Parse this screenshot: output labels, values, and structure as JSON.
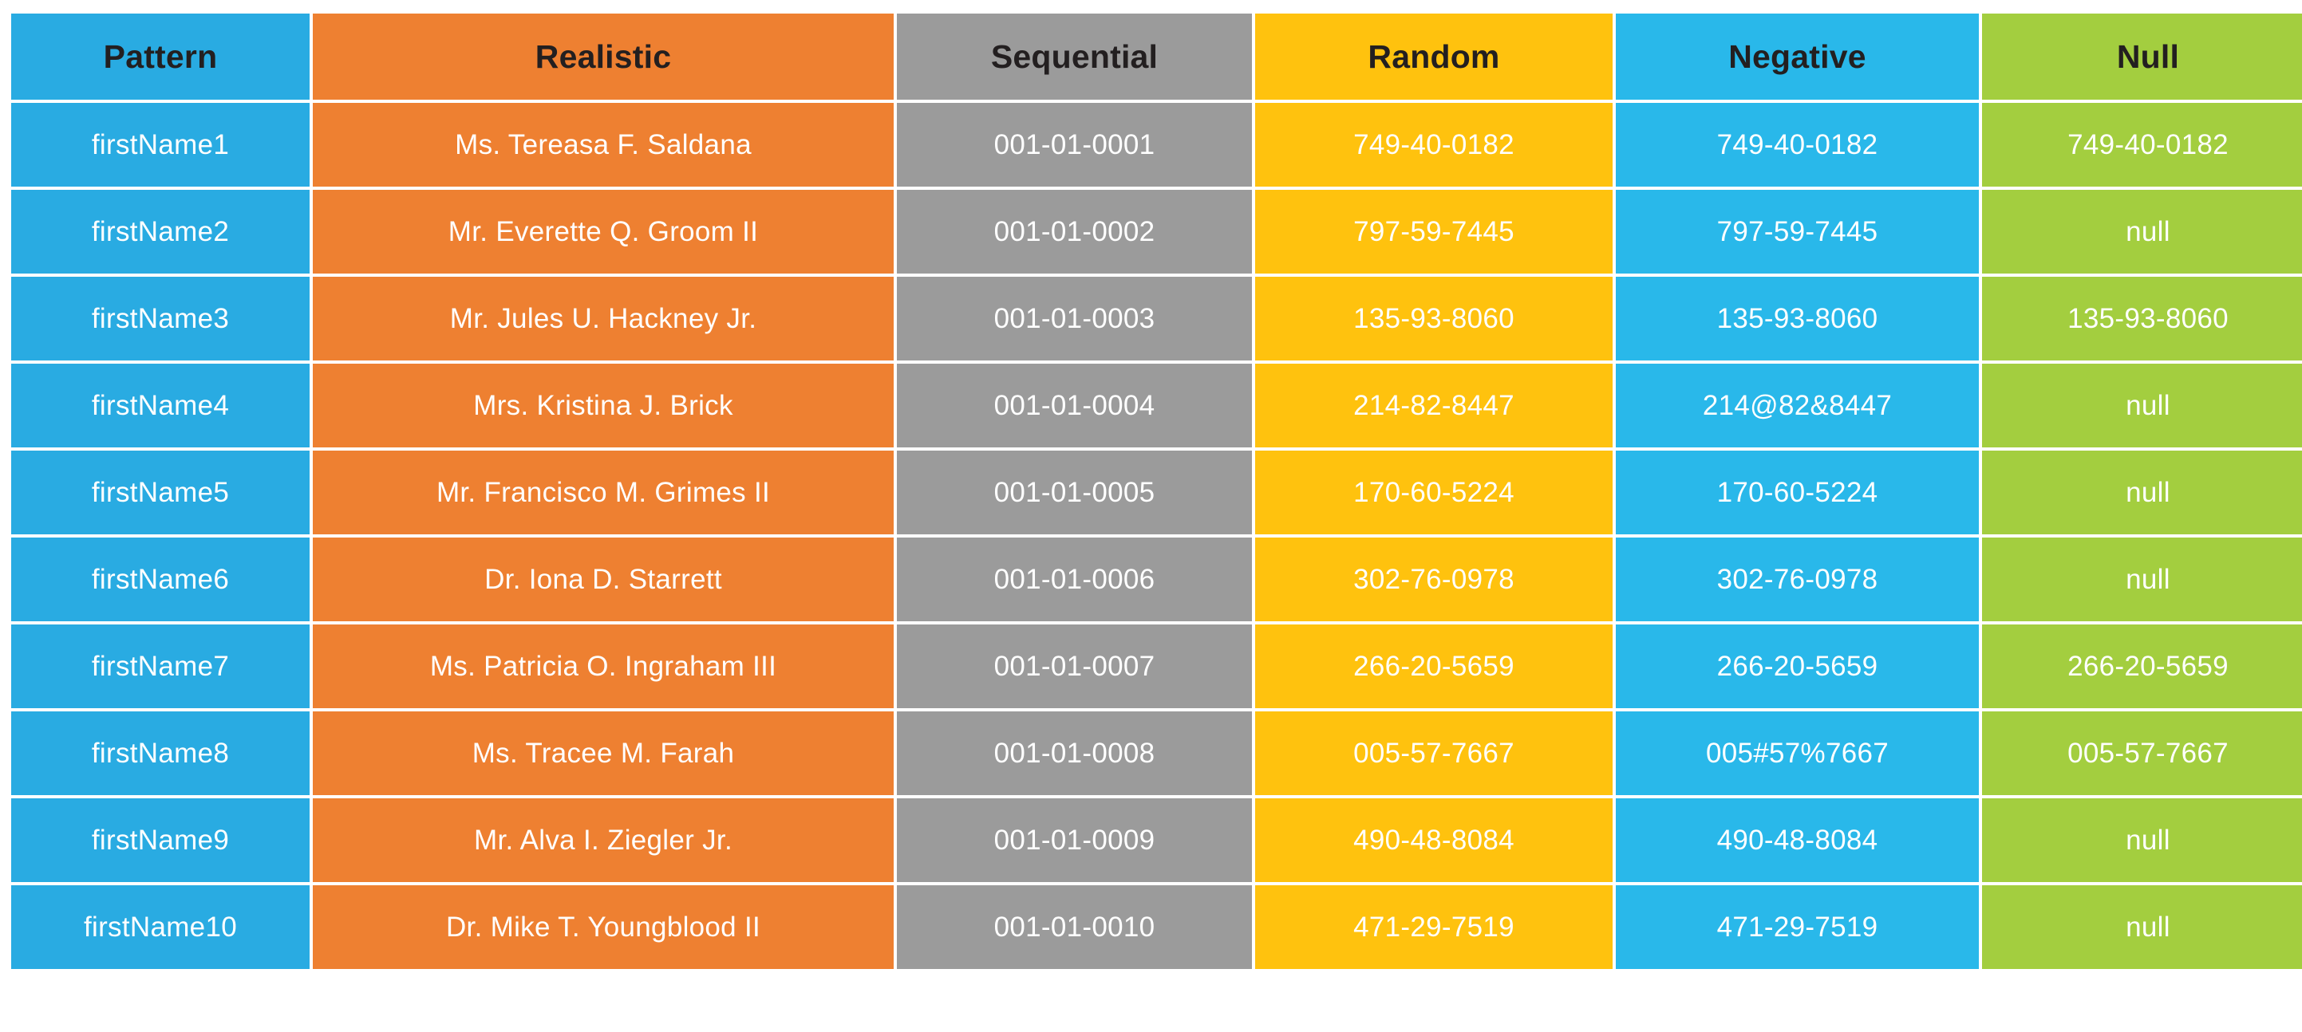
{
  "table": {
    "columns": [
      {
        "key": "pattern",
        "label": "Pattern",
        "color": "#29abe2"
      },
      {
        "key": "realistic",
        "label": "Realistic",
        "color": "#ee8031"
      },
      {
        "key": "sequential",
        "label": "Sequential",
        "color": "#9b9b9b"
      },
      {
        "key": "random",
        "label": "Random",
        "color": "#ffc20e"
      },
      {
        "key": "negative",
        "label": "Negative",
        "color": "#29b8ea"
      },
      {
        "key": "null",
        "label": "Null",
        "color": "#a3ce3f"
      }
    ],
    "rows": [
      {
        "pattern": "firstName1",
        "realistic": "Ms. Tereasa F. Saldana",
        "sequential": "001-01-0001",
        "random": "749-40-0182",
        "negative": "749-40-0182",
        "null": "749-40-0182"
      },
      {
        "pattern": "firstName2",
        "realistic": "Mr. Everette Q. Groom II",
        "sequential": "001-01-0002",
        "random": "797-59-7445",
        "negative": "797-59-7445",
        "null": "null"
      },
      {
        "pattern": "firstName3",
        "realistic": "Mr. Jules U. Hackney Jr.",
        "sequential": "001-01-0003",
        "random": "135-93-8060",
        "negative": "135-93-8060",
        "null": "135-93-8060"
      },
      {
        "pattern": "firstName4",
        "realistic": "Mrs. Kristina J. Brick",
        "sequential": "001-01-0004",
        "random": "214-82-8447",
        "negative": "214@82&8447",
        "null": "null"
      },
      {
        "pattern": "firstName5",
        "realistic": "Mr. Francisco M. Grimes II",
        "sequential": "001-01-0005",
        "random": "170-60-5224",
        "negative": "170-60-5224",
        "null": "null"
      },
      {
        "pattern": "firstName6",
        "realistic": "Dr. Iona D. Starrett",
        "sequential": "001-01-0006",
        "random": "302-76-0978",
        "negative": "302-76-0978",
        "null": "null"
      },
      {
        "pattern": "firstName7",
        "realistic": "Ms. Patricia O. Ingraham III",
        "sequential": "001-01-0007",
        "random": "266-20-5659",
        "negative": "266-20-5659",
        "null": "266-20-5659"
      },
      {
        "pattern": "firstName8",
        "realistic": "Ms. Tracee M. Farah",
        "sequential": "001-01-0008",
        "random": "005-57-7667",
        "negative": "005#57%7667",
        "null": "005-57-7667"
      },
      {
        "pattern": "firstName9",
        "realistic": "Mr. Alva I. Ziegler Jr.",
        "sequential": "001-01-0009",
        "random": "490-48-8084",
        "negative": "490-48-8084",
        "null": "null"
      },
      {
        "pattern": "firstName10",
        "realistic": "Dr. Mike T. Youngblood II",
        "sequential": "001-01-0010",
        "random": "471-29-7519",
        "negative": "471-29-7519",
        "null": "null"
      }
    ]
  }
}
